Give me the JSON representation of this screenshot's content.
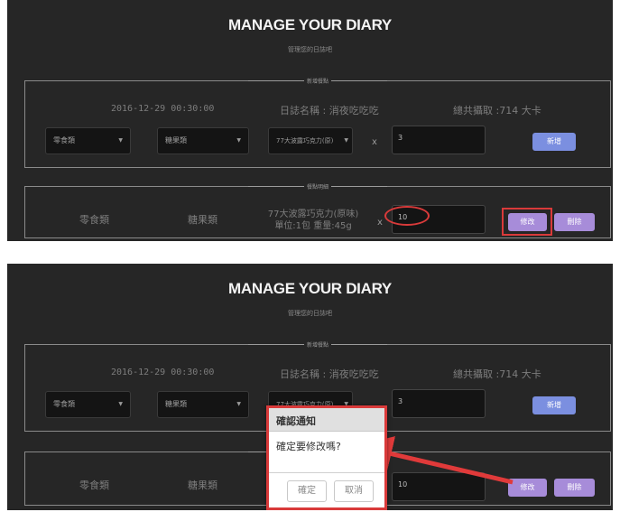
{
  "title": "MANAGE YOUR DIARY",
  "subtitle": "管理您的日誌吧",
  "add_panel": {
    "label": "新增餐點",
    "datetime": "2016-12-29 00:30:00",
    "diary_name": "日誌名稱 : 消夜吃吃吃",
    "total": "總共攝取 :714 大卡",
    "category": "零食類",
    "subcategory": "糖果類",
    "item": "77大波露巧克力(原)",
    "quantity": "3",
    "multiply": "x",
    "add_button": "新增"
  },
  "detail_panel": {
    "label": "餐點明細",
    "category": "零食類",
    "subcategory": "糖果類",
    "item_name": "77大波露巧克力(原味)",
    "item_info": "單位:1包 重量:45g",
    "multiply": "x",
    "quantity": "10",
    "edit_button": "修改",
    "delete_button": "刪除"
  },
  "dialog": {
    "title": "確認通知",
    "message": "確定要修改嗎?",
    "confirm": "確定",
    "cancel": "取消"
  },
  "colors": {
    "background": "#262626",
    "accent_blue": "#7b8fe0",
    "accent_purple": "#a78cd9",
    "annotation_red": "#d93a3a"
  }
}
